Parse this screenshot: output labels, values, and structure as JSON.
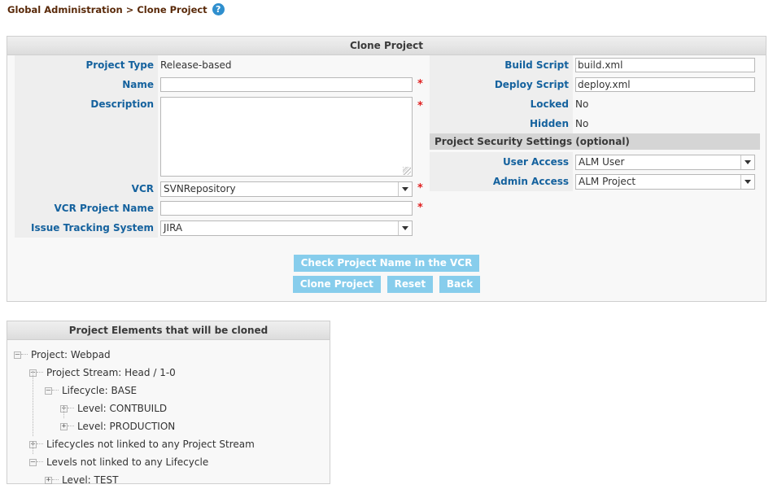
{
  "breadcrumb": {
    "text": "Global Administration > Clone Project",
    "help_icon": "help-circle-icon",
    "help_glyph": "?"
  },
  "form_panel": {
    "title": "Clone Project",
    "left_fields": [
      {
        "label": "Project Type",
        "type": "static",
        "value": "Release-based",
        "required": false
      },
      {
        "label": "Name",
        "type": "text",
        "value": "",
        "required": true
      },
      {
        "label": "Description",
        "type": "textarea",
        "value": "",
        "required": true
      },
      {
        "label": "VCR",
        "type": "select",
        "value": "SVNRepository",
        "required": true
      },
      {
        "label": "VCR Project Name",
        "type": "text",
        "value": "",
        "required": true
      },
      {
        "label": "Issue Tracking System",
        "type": "select",
        "value": "JIRA",
        "required": false
      }
    ],
    "right_fields": [
      {
        "label": "Build Script",
        "type": "text",
        "value": "build.xml"
      },
      {
        "label": "Deploy Script",
        "type": "text",
        "value": "deploy.xml"
      },
      {
        "label": "Locked",
        "type": "static",
        "value": "No"
      },
      {
        "label": "Hidden",
        "type": "static",
        "value": "No"
      }
    ],
    "security_section": {
      "title": "Project Security Settings (optional)",
      "fields": [
        {
          "label": "User Access",
          "type": "select",
          "value": "ALM User"
        },
        {
          "label": "Admin Access",
          "type": "select",
          "value": "ALM Project"
        }
      ]
    },
    "buttons": {
      "check_vcr": "Check Project Name in the VCR",
      "clone": "Clone Project",
      "reset": "Reset",
      "back": "Back"
    },
    "required_marker": "*"
  },
  "tree_panel": {
    "title": "Project Elements that will be cloned",
    "nodes": [
      {
        "label": "Project: Webpad",
        "depth": 0,
        "state": "expanded",
        "glyph": "–"
      },
      {
        "label": "Project Stream: Head / 1-0",
        "depth": 1,
        "state": "expanded",
        "glyph": "–"
      },
      {
        "label": "Lifecycle: BASE",
        "depth": 2,
        "state": "expanded",
        "glyph": "–"
      },
      {
        "label": "Level: CONTBUILD",
        "depth": 3,
        "state": "collapsed",
        "glyph": "+"
      },
      {
        "label": "Level: PRODUCTION",
        "depth": 3,
        "state": "collapsed",
        "glyph": "+"
      },
      {
        "label": "Lifecycles not linked to any Project Stream",
        "depth": 1,
        "state": "collapsed",
        "glyph": "+"
      },
      {
        "label": "Levels not linked to any Lifecycle",
        "depth": 1,
        "state": "expanded",
        "glyph": "–"
      },
      {
        "label": "Level: TEST",
        "depth": 2,
        "state": "collapsed",
        "glyph": "+"
      }
    ]
  },
  "colors": {
    "label_blue": "#15629e",
    "breadcrumb_brown": "#5a2a0a",
    "button_blue": "#87cdec",
    "required_red": "#e02020",
    "help_blue": "#2f8fce",
    "section_gray": "#d5d5d5"
  }
}
